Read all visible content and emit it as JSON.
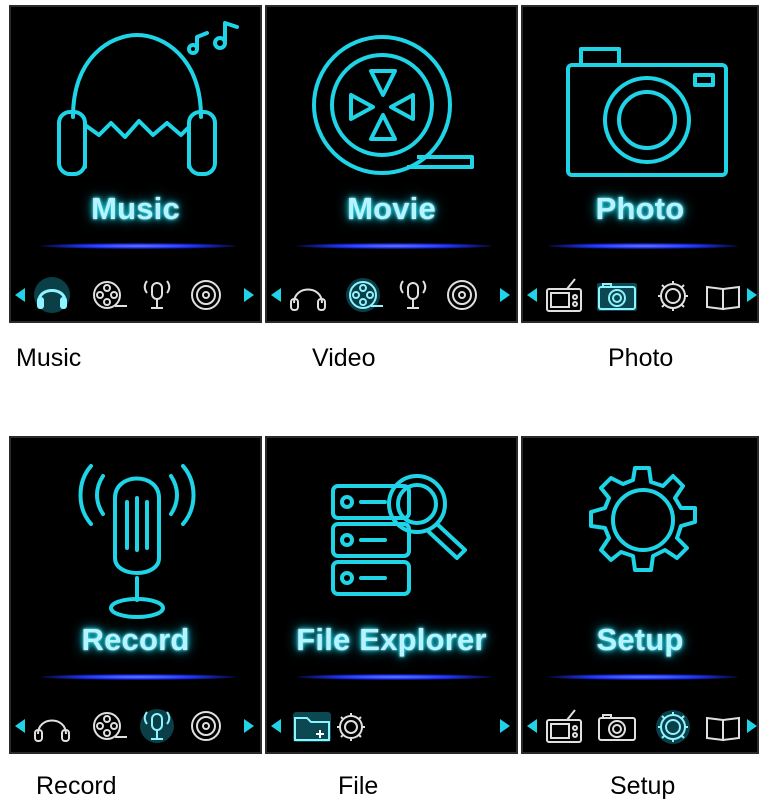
{
  "colors": {
    "accent": "#1fd4e6",
    "glow_blue": "#2236ff",
    "screen_bg": "#000000"
  },
  "screens": [
    {
      "id": "music",
      "title": "Music",
      "caption": "Music",
      "icon": "headphones-music-icon",
      "iconbar": [
        "left-arrow-icon",
        "headphones-icon",
        "film-reel-icon",
        "microphone-icon",
        "disc-icon",
        "right-arrow-icon"
      ],
      "selected": "headphones-icon"
    },
    {
      "id": "movie",
      "title": "Movie",
      "caption": "Video",
      "icon": "film-reel-icon",
      "iconbar": [
        "left-arrow-icon",
        "headphones-icon",
        "film-reel-icon",
        "microphone-icon",
        "disc-icon",
        "right-arrow-icon"
      ],
      "selected": "film-reel-icon"
    },
    {
      "id": "photo",
      "title": "Photo",
      "caption": "Photo",
      "icon": "camera-icon",
      "iconbar": [
        "left-arrow-icon",
        "radio-icon",
        "camera-icon",
        "gear-icon",
        "book-icon",
        "right-arrow-icon"
      ],
      "selected": "camera-icon"
    },
    {
      "id": "record",
      "title": "Record",
      "caption": "Record",
      "icon": "microphone-icon",
      "iconbar": [
        "left-arrow-icon",
        "headphones-icon",
        "film-reel-icon",
        "microphone-icon",
        "disc-icon",
        "right-arrow-icon"
      ],
      "selected": "microphone-icon"
    },
    {
      "id": "file",
      "title": "File Explorer",
      "caption": "File",
      "icon": "file-explorer-icon",
      "iconbar": [
        "left-arrow-icon",
        "folder-icon",
        "gear-icon",
        "right-arrow-icon"
      ],
      "selected": "folder-icon"
    },
    {
      "id": "setup",
      "title": "Setup",
      "caption": "Setup",
      "icon": "gear-icon",
      "iconbar": [
        "left-arrow-icon",
        "radio-icon",
        "camera-icon",
        "gear-icon",
        "book-icon",
        "right-arrow-icon"
      ],
      "selected": "gear-icon"
    }
  ]
}
